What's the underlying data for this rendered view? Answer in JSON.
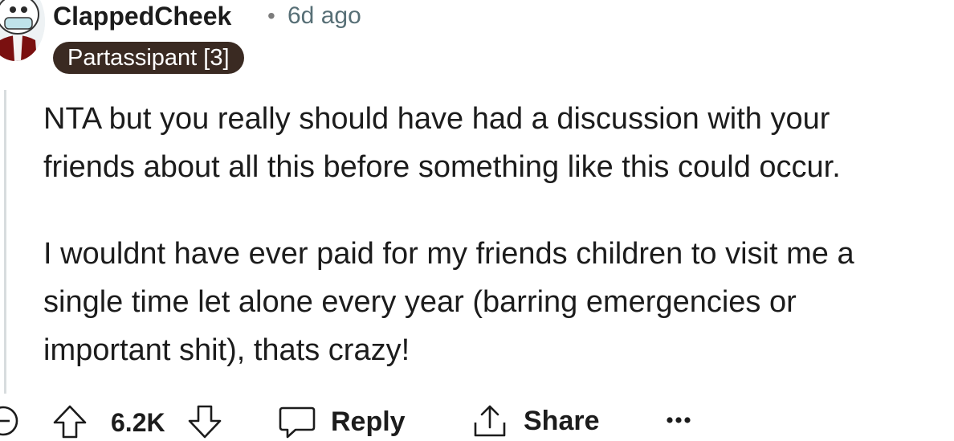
{
  "comment": {
    "author": "ClappedCheek",
    "separator": "•",
    "timestamp": "6d ago",
    "flair": "Partassipant [3]",
    "paragraphs": [
      "NTA but you really should have had a discussion with your\nfriends about all this before something like this could occur.",
      "I wouldnt have ever paid for my friends children to visit me a\nsingle time let alone every year (barring emergencies or\nimportant shit), thats crazy!"
    ]
  },
  "actions": {
    "vote_count": "6.2K",
    "reply_label": "Reply",
    "share_label": "Share",
    "more_label": "•••"
  },
  "icons": {
    "avatar": "avatar",
    "collapse": "collapse-icon",
    "upvote": "upvote-arrow-icon",
    "downvote": "downvote-arrow-icon",
    "reply": "speech-bubble-icon",
    "share": "share-arrow-icon",
    "more": "more-dots-icon"
  },
  "colors": {
    "flair_bg": "#3a2a22",
    "text": "#1c1c1c",
    "meta": "#576f76",
    "thread_line": "#d8dcde"
  }
}
